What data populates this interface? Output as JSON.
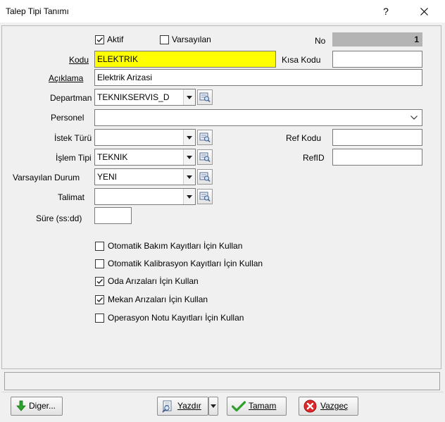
{
  "window": {
    "title": "Talep Tipi Tanımı",
    "help": "?",
    "close": "×"
  },
  "form": {
    "aktif_label": "Aktif",
    "aktif_checked": true,
    "varsayilan_label": "Varsayılan",
    "varsayilan_checked": false,
    "no_label": "No",
    "no_value": "1",
    "kodu_label": "Kodu",
    "kodu_value": "ELEKTRIK",
    "kisa_kodu_label": "Kısa Kodu",
    "kisa_kodu_value": "",
    "aciklama_label": "Açıklama",
    "aciklama_value": "Elektrik Arizasi",
    "departman_label": "Departman",
    "departman_value": "TEKNIKSERVIS_D",
    "personel_label": "Personel",
    "personel_value": "",
    "istek_turu_label": "İstek Türü",
    "istek_turu_value": "",
    "ref_kodu_label": "Ref Kodu",
    "ref_kodu_value": "",
    "islem_tipi_label": "İşlem Tipi",
    "islem_tipi_value": "TEKNIK",
    "refid_label": "RefID",
    "refid_value": "",
    "varsayilan_durum_label": "Varsayılan Durum",
    "varsayilan_durum_value": "YENI",
    "talimat_label": "Talimat",
    "talimat_value": "",
    "sure_label": "Süre (ss:dd)",
    "sure_value": ""
  },
  "options": [
    {
      "label": "Otomatik Bakım Kayıtları İçin Kullan",
      "checked": false
    },
    {
      "label": "Otomatik Kalibrasyon Kayıtları İçin Kullan",
      "checked": false
    },
    {
      "label": "Oda Arızaları İçin Kullan",
      "checked": true
    },
    {
      "label": "Mekan Arızaları İçin Kullan",
      "checked": true
    },
    {
      "label": "Operasyon Notu Kayıtları İçin Kullan",
      "checked": false
    }
  ],
  "buttons": {
    "diger": "Diger...",
    "yazdir": "Yazdır",
    "tamam": "Tamam",
    "vazgec": "Vazgeç"
  },
  "icons": {
    "lookup": "lookup-icon",
    "arrow": "green-down-arrow-icon",
    "printer": "print-preview-icon",
    "check": "green-check-icon",
    "cancel": "red-x-icon"
  },
  "colors": {
    "highlight": "#ffff00",
    "readonly": "#b4b4b4"
  }
}
